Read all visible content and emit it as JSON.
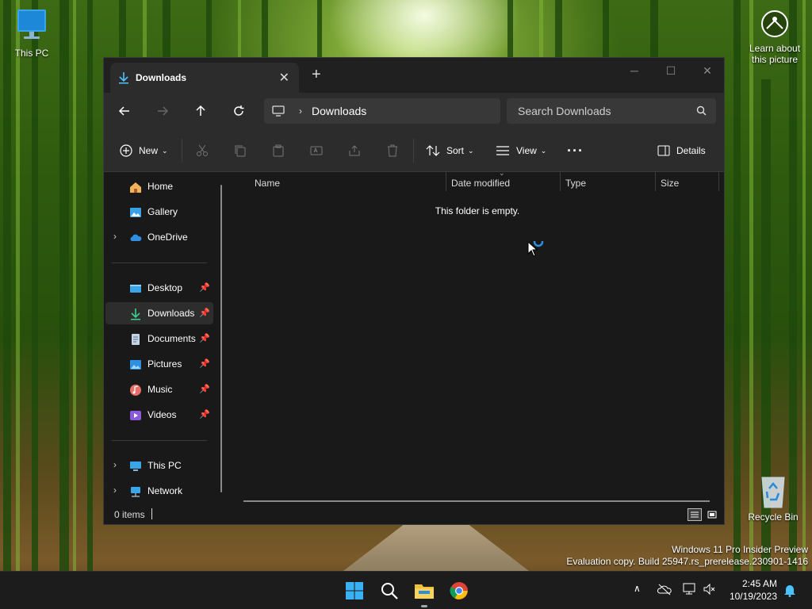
{
  "desktop": {
    "this_pc_label": "This PC",
    "learn_label_line1": "Learn about",
    "learn_label_line2": "this picture",
    "recycle_bin_label": "Recycle Bin",
    "watermark_line1": "Windows 11 Pro Insider Preview",
    "watermark_line2": "Evaluation copy. Build 25947.rs_prerelease.230901-1416"
  },
  "window": {
    "tab_title": "Downloads",
    "address_crumb": "Downloads",
    "search_placeholder": "Search Downloads",
    "commands": {
      "new_label": "New",
      "sort_label": "Sort",
      "view_label": "View",
      "details_label": "Details"
    },
    "sidebar": {
      "home": "Home",
      "gallery": "Gallery",
      "onedrive": "OneDrive",
      "desktop": "Desktop",
      "downloads": "Downloads",
      "documents": "Documents",
      "pictures": "Pictures",
      "music": "Music",
      "videos": "Videos",
      "this_pc": "This PC",
      "network": "Network"
    },
    "columns": {
      "name": "Name",
      "date_modified": "Date modified",
      "type": "Type",
      "size": "Size"
    },
    "empty_message": "This folder is empty.",
    "status_items": "0 items"
  },
  "taskbar": {
    "time": "2:45 AM",
    "date": "10/19/2023"
  },
  "colors": {
    "accent": "#4cc2ff",
    "window_bg": "#191919",
    "toolbar_bg": "#2c2c2c"
  }
}
